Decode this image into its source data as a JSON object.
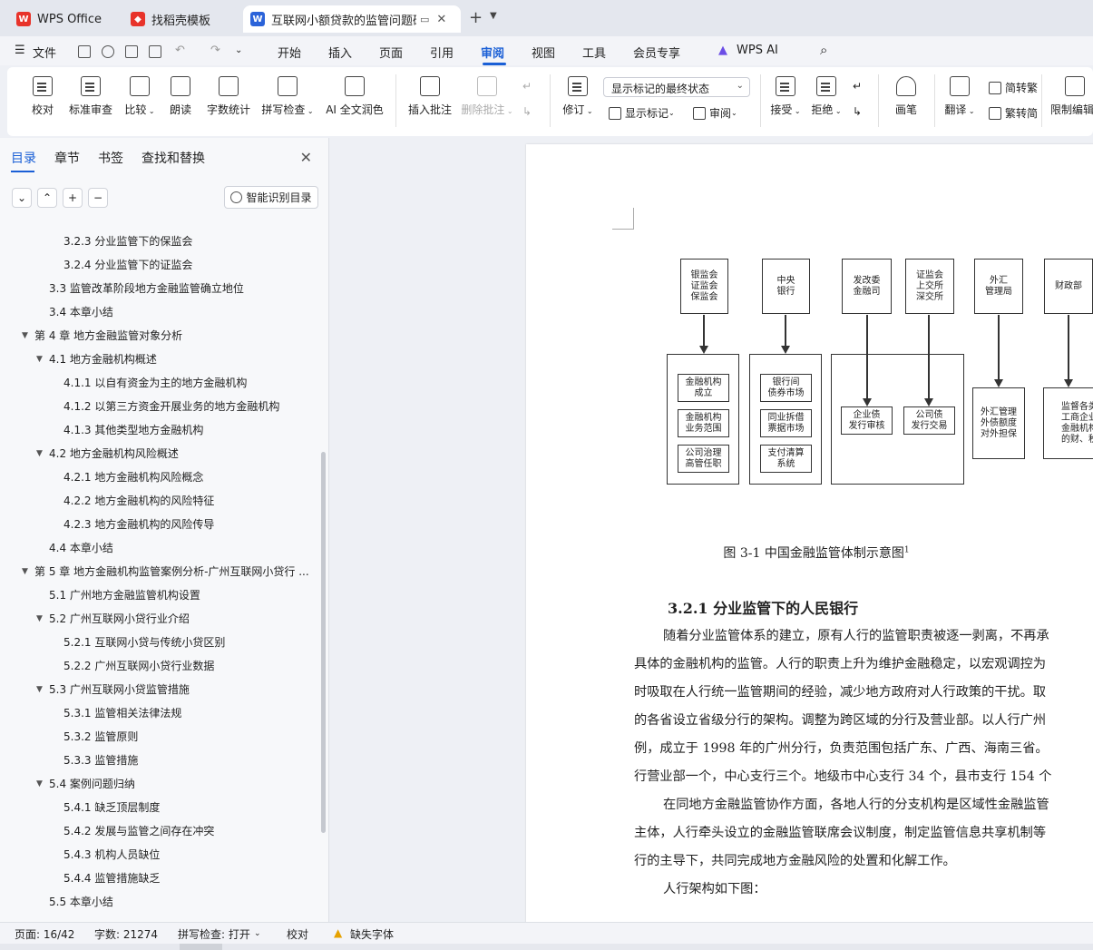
{
  "tabs": [
    {
      "label": "WPS Office",
      "icon": "wps-logo-icon",
      "active": false
    },
    {
      "label": "找稻壳模板",
      "icon": "docer-icon",
      "active": false
    },
    {
      "label": "互联网小额贷款的监管问题研",
      "icon": "word-doc-icon",
      "active": true
    }
  ],
  "menu": {
    "file": "文件",
    "items": [
      "开始",
      "插入",
      "页面",
      "引用",
      "审阅",
      "视图",
      "工具",
      "会员专享",
      "WPS AI"
    ],
    "active": "审阅"
  },
  "ribbon": {
    "buttons": [
      "校对",
      "标准审查",
      "比较",
      "朗读",
      "字数统计",
      "拼写检查",
      "AI 全文润色",
      "插入批注",
      "删除批注",
      "修订",
      "接受",
      "拒绝",
      "画笔",
      "翻译",
      "限制编辑"
    ],
    "show_markup_select": "显示标记的最终状态",
    "show_markup": "显示标记",
    "review": "审阅",
    "to_traditional": "简转繁",
    "to_simplified": "繁转简"
  },
  "left_panel": {
    "tabs": [
      "目录",
      "章节",
      "书签",
      "查找和替换"
    ],
    "smart_toc": "智能识别目录",
    "toc": [
      {
        "level": 3,
        "text": "3.2.3  分业监管下的保监会"
      },
      {
        "level": 3,
        "text": "3.2.4  分业监管下的证监会"
      },
      {
        "level": 2,
        "text": "3.3  监管改革阶段地方金融监管确立地位"
      },
      {
        "level": 2,
        "text": "3.4  本章小结"
      },
      {
        "level": 1,
        "text": "第 4 章  地方金融监管对象分析",
        "expanded": true
      },
      {
        "level": 2,
        "text": "4.1  地方金融机构概述",
        "expanded": true
      },
      {
        "level": 3,
        "text": "4.1.1  以自有资金为主的地方金融机构"
      },
      {
        "level": 3,
        "text": "4.1.2  以第三方资金开展业务的地方金融机构"
      },
      {
        "level": 3,
        "text": "4.1.3  其他类型地方金融机构"
      },
      {
        "level": 2,
        "text": "4.2  地方金融机构风险概述",
        "expanded": true
      },
      {
        "level": 3,
        "text": "4.2.1  地方金融机构风险概念"
      },
      {
        "level": 3,
        "text": "4.2.2  地方金融机构的风险特征"
      },
      {
        "level": 3,
        "text": "4.2.3  地方金融机构的风险传导"
      },
      {
        "level": 2,
        "text": "4.4  本章小结"
      },
      {
        "level": 1,
        "text": "第 5 章  地方金融机构监管案例分析-广州互联网小贷行 ...",
        "expanded": true
      },
      {
        "level": 2,
        "text": "5.1  广州地方金融监管机构设置"
      },
      {
        "level": 2,
        "text": "5.2  广州互联网小贷行业介绍",
        "expanded": true
      },
      {
        "level": 3,
        "text": "5.2.1  互联网小贷与传统小贷区别"
      },
      {
        "level": 3,
        "text": "5.2.2  广州互联网小贷行业数据"
      },
      {
        "level": 2,
        "text": "5.3  广州互联网小贷监管措施",
        "expanded": true
      },
      {
        "level": 3,
        "text": "5.3.1  监管相关法律法规"
      },
      {
        "level": 3,
        "text": "5.3.2  监管原则"
      },
      {
        "level": 3,
        "text": "5.3.3  监管措施"
      },
      {
        "level": 2,
        "text": "5.4  案例问题归纳",
        "expanded": true
      },
      {
        "level": 3,
        "text": "5.4.1  缺乏顶层制度"
      },
      {
        "level": 3,
        "text": "5.4.2  发展与监管之间存在冲突"
      },
      {
        "level": 3,
        "text": "5.4.3  机构人员缺位"
      },
      {
        "level": 3,
        "text": "5.4.4  监管措施缺乏"
      },
      {
        "level": 2,
        "text": "5.5  本章小结"
      }
    ]
  },
  "document": {
    "diagram": {
      "top_boxes": [
        "银监会\n证监会\n保监会",
        "中央\n银行",
        "发改委\n金融司",
        "证监会\n上交所\n深交所",
        "外汇\n管理局",
        "财政部"
      ],
      "group1": [
        "金融机构\n成立",
        "金融机构\n业务范围",
        "公司治理\n高管任职"
      ],
      "group2": [
        "银行间\n债券市场",
        "同业拆借\n票据市场",
        "支付清算\n系统"
      ],
      "group3": [
        "企业债\n发行审核",
        "公司债\n发行交易"
      ],
      "box_forex": "外汇管理\n外债额度\n对外担保",
      "box_finance": "监督各类\n工商企业\n金融机构\n的财、税"
    },
    "caption": "图 3-1    中国金融监管体制示意图",
    "caption_sup": "1",
    "heading": "3.2.1  分业监管下的人民银行",
    "paragraphs": [
      "随着分业监管体系的建立，原有人行的监管职责被逐一剥离，不再承",
      "具体的金融机构的监管。人行的职责上升为维护金融稳定，以宏观调控为",
      "时吸取在人行统一监管期间的经验，减少地方政府对人行政策的干扰。取",
      "的各省设立省级分行的架构。调整为跨区域的分行及营业部。以人行广州",
      "例，成立于 1998 年的广州分行，负责范围包括广东、广西、海南三省。",
      "行营业部一个，中心支行三个。地级市中心支行 34 个，县市支行 154 个",
      "在同地方金融监管协作方面，各地人行的分支机构是区域性金融监管",
      "主体，人行牵头设立的金融监管联席会议制度，制定监管信息共享机制等",
      "行的主导下，共同完成地方金融风险的处置和化解工作。",
      "人行架构如下图："
    ]
  },
  "status": {
    "page": "页面: 16/42",
    "words": "字数: 21274",
    "spell": "拼写检查: 打开",
    "proof": "校对",
    "missing_font": "缺失字体"
  }
}
